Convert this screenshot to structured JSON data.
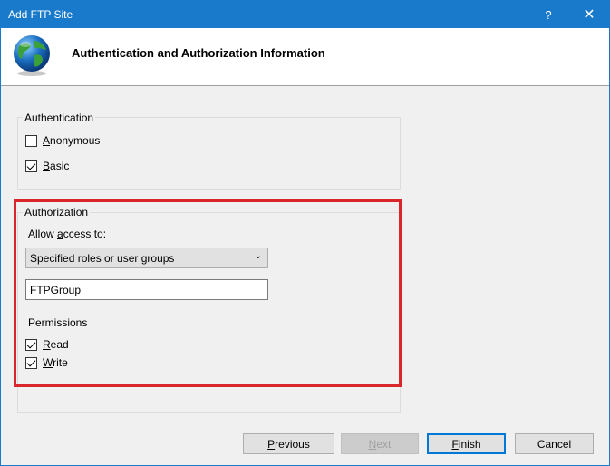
{
  "window": {
    "title": "Add FTP Site",
    "help_glyph": "?",
    "close_glyph": "✕"
  },
  "header": {
    "title": "Authentication and Authorization Information"
  },
  "authentication": {
    "legend": "Authentication",
    "anonymous": {
      "label_accel": "A",
      "label_rest": "nonymous",
      "checked": false
    },
    "basic": {
      "label_accel": "B",
      "label_rest": "asic",
      "checked": true
    }
  },
  "authorization": {
    "legend": "Authorization",
    "allow_label_pre": "Allow ",
    "allow_label_accel": "a",
    "allow_label_post": "ccess to:",
    "allow_selected": "Specified roles or user groups",
    "chevron": "⌄",
    "group_value": "FTPGroup",
    "permissions_label": "Permissions",
    "read": {
      "label_accel": "R",
      "label_rest": "ead",
      "checked": true
    },
    "write": {
      "label_accel": "W",
      "label_rest": "rite",
      "checked": true
    }
  },
  "footer": {
    "previous_accel": "P",
    "previous_rest": "revious",
    "next_accel": "N",
    "next_rest": "ext",
    "finish_accel": "F",
    "finish_rest": "inish",
    "cancel": "Cancel"
  },
  "colors": {
    "titlebar": "#1979ca",
    "highlight": "#d9262c"
  },
  "icons": {
    "header": "globe-icon"
  }
}
